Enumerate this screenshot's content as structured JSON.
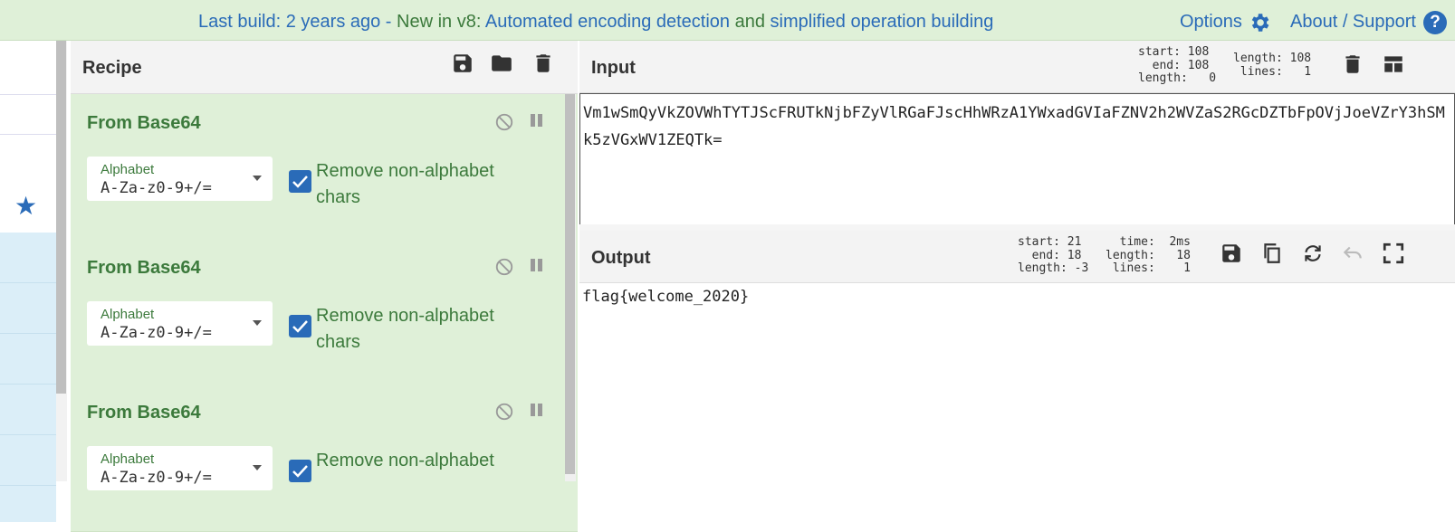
{
  "banner": {
    "last_build": "Last build: 2 years ago",
    "dash": " - ",
    "new_in": "New in v8:",
    "feature1": " Automated encoding detection",
    "and": " and ",
    "feature2": "simplified operation building",
    "options": "Options",
    "about": "About / Support",
    "help": "?"
  },
  "recipe": {
    "title": "Recipe",
    "operations": [
      {
        "name": "From Base64",
        "alphabet_label": "Alphabet",
        "alphabet_value": "A-Za-z0-9+/=",
        "checkbox_label": "Remove non-alphabet chars",
        "checked": true
      },
      {
        "name": "From Base64",
        "alphabet_label": "Alphabet",
        "alphabet_value": "A-Za-z0-9+/=",
        "checkbox_label": "Remove non-alphabet chars",
        "checked": true
      },
      {
        "name": "From Base64",
        "alphabet_label": "Alphabet",
        "alphabet_value": "A-Za-z0-9+/=",
        "checkbox_label": "Remove non-alphabet",
        "checked": true
      }
    ]
  },
  "input": {
    "title": "Input",
    "stats_sel": "start: 108\n  end: 108\nlength:   0",
    "stats_len": "length: 108\n lines:   1",
    "text": "Vm1wSmQyVkZOVWhTYTJScFRUTkNjbFZyVlRGaFJscHhWRzA1YWxadGVIaFZNV2h2WVZaS2RGcDZTbFpOVjJoeVZrY3hSMk5zVGxWV1ZEQTk="
  },
  "output": {
    "title": "Output",
    "stats_sel": "start: 21\n  end: 18\nlength: -3",
    "stats_time": "  time:  2ms\nlength:   18\n lines:    1",
    "text": "flag{welcome_2020}"
  },
  "colors": {
    "banner_bg": "#dff0d8",
    "recipe_op_bg": "#dff0d8",
    "accent_blue": "#2a6bb8",
    "op_green": "#3c7a3c"
  },
  "icons": [
    "gear-icon",
    "help-icon",
    "star-icon",
    "save-icon",
    "folder-icon",
    "trash-icon",
    "disable-icon",
    "pause-icon",
    "layout-icon",
    "copy-icon",
    "swap-icon",
    "undo-icon",
    "maximise-icon"
  ]
}
